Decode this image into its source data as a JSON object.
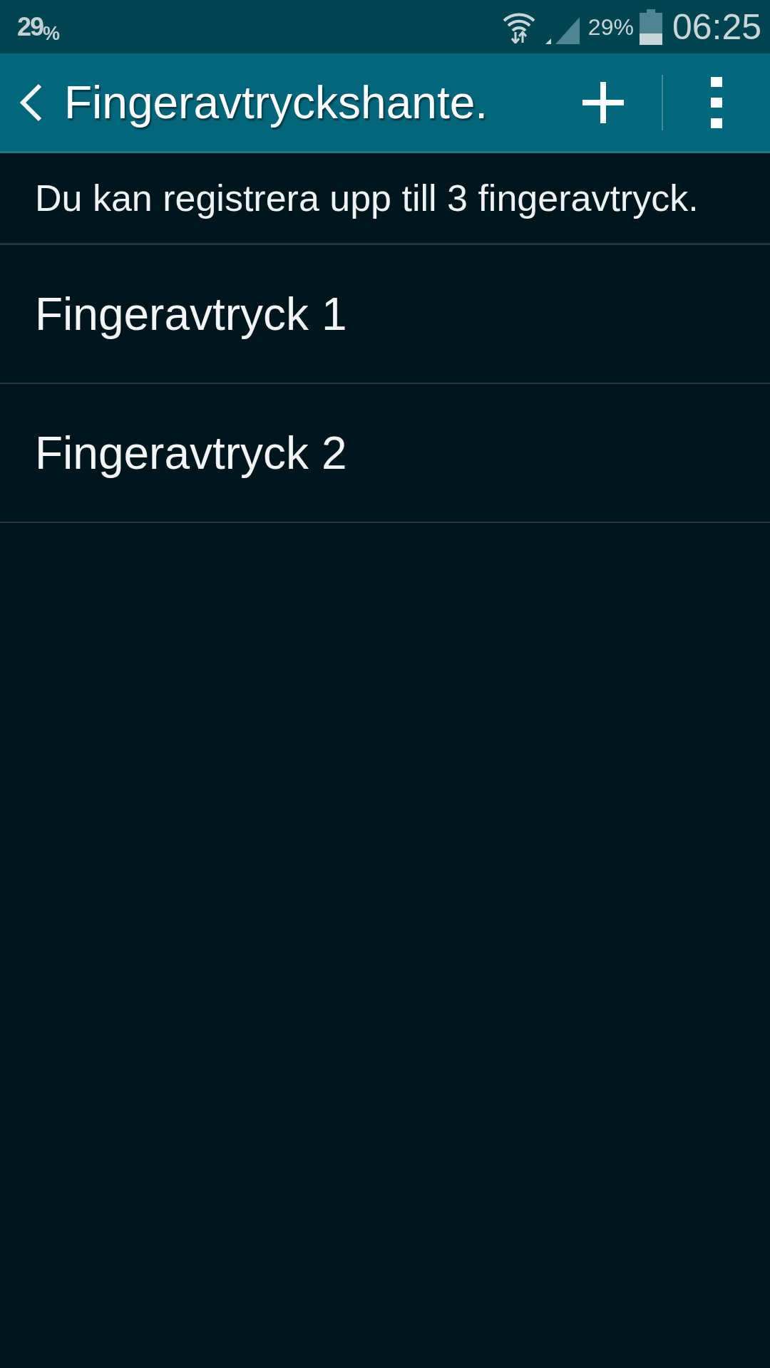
{
  "status_bar": {
    "notification": "29$_{%}$",
    "battery_percent": "29%",
    "time": "06:25"
  },
  "app_bar": {
    "title": "Fingeravtryckshante."
  },
  "info_text": "Du kan registrera upp till 3 fingeravtryck.",
  "fingerprints": [
    {
      "label": "Fingeravtryck 1"
    },
    {
      "label": "Fingeravtryck 2"
    }
  ]
}
